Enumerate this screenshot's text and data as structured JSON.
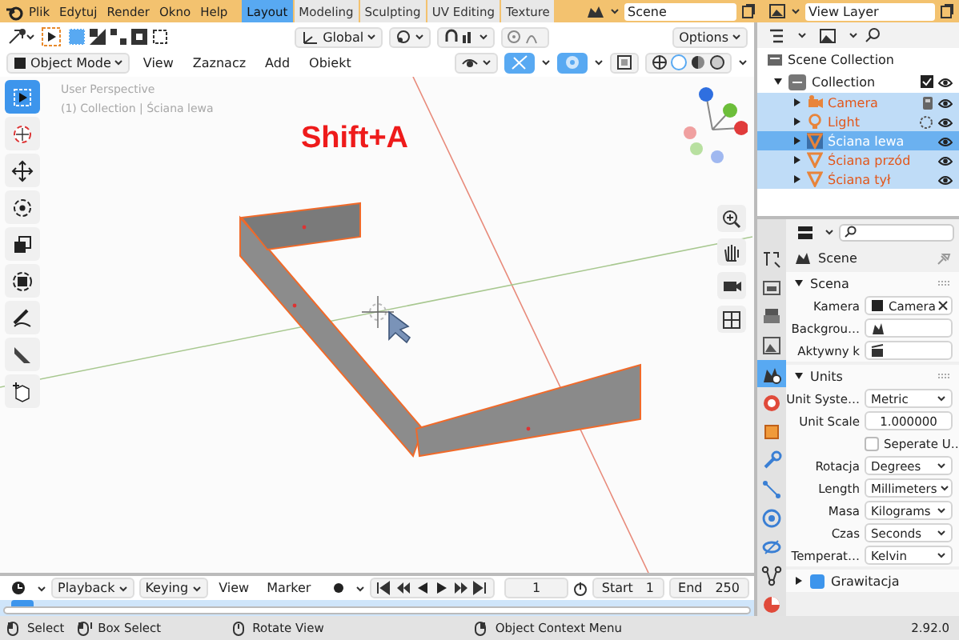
{
  "menu_bar": {
    "items": [
      "Plik",
      "Edytuj",
      "Render",
      "Okno",
      "Help"
    ],
    "workspaces": [
      {
        "label": "Layout",
        "selected": true
      },
      {
        "label": "Modeling",
        "selected": false
      },
      {
        "label": "Sculpting",
        "selected": false
      },
      {
        "label": "UV Editing",
        "selected": false
      },
      {
        "label": "Texture",
        "selected": false
      }
    ],
    "scene": "Scene",
    "view_layer": "View Layer"
  },
  "viewport": {
    "orientation": "Global",
    "options": "Options",
    "mode": "Object Mode",
    "menus": [
      "View",
      "Zaznacz",
      "Add",
      "Obiekt"
    ],
    "gizmos_on": true,
    "overlays_on": true,
    "overlay_text": [
      "User Perspective",
      "(1) Collection | Ściana lewa"
    ],
    "hint": "Shift+A",
    "tools": [
      {
        "selected": true
      },
      {
        "selected": false
      },
      {
        "selected": false
      },
      {
        "selected": false
      },
      {
        "selected": false
      },
      {
        "selected": false
      },
      {
        "selected": false
      },
      {
        "selected": false
      },
      {
        "selected": false
      }
    ]
  },
  "outliner": {
    "scene_collection": "Scene Collection",
    "collection": {
      "name": "Collection",
      "expanded": true,
      "checked": true,
      "children": [
        {
          "name": "Camera",
          "kind": "camera",
          "selected": true,
          "active": false
        },
        {
          "name": "Light",
          "kind": "light",
          "selected": true,
          "active": false
        },
        {
          "name": "Ściana lewa",
          "kind": "mesh",
          "selected": true,
          "active": true
        },
        {
          "name": "Ściana przód",
          "kind": "mesh",
          "selected": true,
          "active": false
        },
        {
          "name": "Ściana tył",
          "kind": "mesh",
          "selected": true,
          "active": false
        }
      ]
    }
  },
  "properties": {
    "tabs": [
      {
        "selected": false
      },
      {
        "selected": false
      },
      {
        "selected": false
      },
      {
        "selected": false
      },
      {
        "selected": true
      },
      {
        "selected": false
      },
      {
        "selected": false
      },
      {
        "selected": false
      },
      {
        "selected": false
      },
      {
        "selected": false
      },
      {
        "selected": false
      },
      {
        "selected": false
      },
      {
        "selected": false
      }
    ],
    "title": "Scene",
    "panels": [
      {
        "title": "Scena",
        "expanded": true,
        "rows": [
          {
            "kind": "object",
            "label": "Kamera",
            "value": "Camera"
          },
          {
            "kind": "scene",
            "label": "Backgrou…"
          },
          {
            "kind": "clip",
            "label": "Aktywny k"
          }
        ]
      },
      {
        "title": "Units",
        "expanded": true,
        "rows": [
          {
            "kind": "dropdown",
            "label": "Unit Syste…",
            "value": "Metric"
          },
          {
            "kind": "number",
            "label": "Unit Scale",
            "value": "1.000000"
          },
          {
            "kind": "checkbox",
            "label": "Seperate U…",
            "checked": false
          },
          {
            "kind": "dropdown",
            "label": "Rotacja",
            "value": "Degrees"
          },
          {
            "kind": "dropdown",
            "label": "Length",
            "value": "Millimeters"
          },
          {
            "kind": "dropdown",
            "label": "Masa",
            "value": "Kilograms"
          },
          {
            "kind": "dropdown",
            "label": "Czas",
            "value": "Seconds"
          },
          {
            "kind": "dropdown",
            "label": "Temperat…",
            "value": "Kelvin"
          }
        ]
      },
      {
        "title": "Grawitacja",
        "expanded": false,
        "checked": true
      }
    ]
  },
  "timeline": {
    "menus": [
      {
        "label": "Playback",
        "dropdown": true
      },
      {
        "label": "Keying",
        "dropdown": true
      },
      {
        "label": "View",
        "dropdown": false
      },
      {
        "label": "Marker",
        "dropdown": false
      }
    ],
    "auto_keying": false,
    "current_frame": "1",
    "start_label": "Start",
    "start": "1",
    "end_label": "End",
    "end": "250"
  },
  "status_bar": {
    "items": [
      {
        "kind": "left",
        "label": "Select"
      },
      {
        "kind": "drag",
        "label": "Box Select"
      },
      {
        "kind": "middle",
        "label": "Rotate View"
      },
      {
        "kind": "right",
        "label": "Object Context Menu"
      }
    ],
    "version": "2.92.0"
  }
}
